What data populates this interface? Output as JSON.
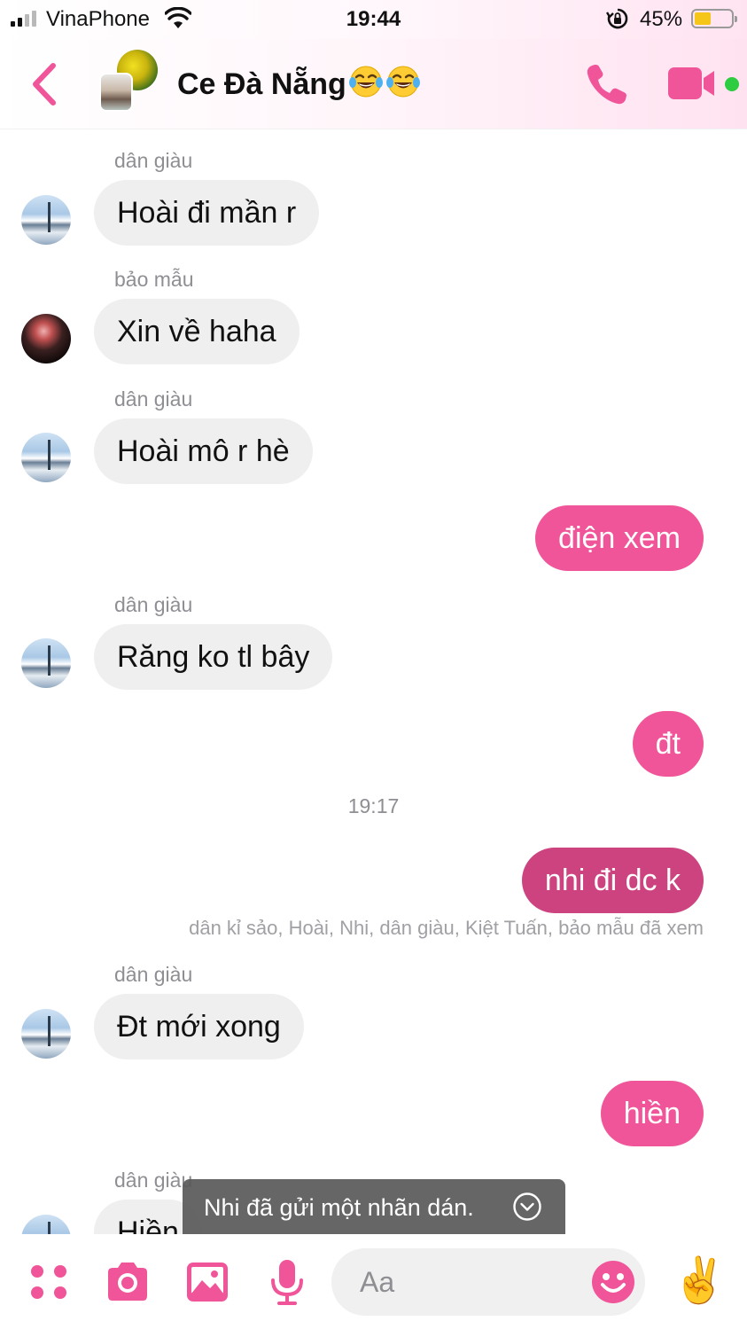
{
  "status_bar": {
    "carrier": "VinaPhone",
    "time": "19:44",
    "battery_percent": "45%",
    "battery_level": 0.45
  },
  "header": {
    "title": "Ce Đà Nẵng",
    "title_emojis": [
      "face-with-tears-of-joy",
      "face-with-tears-of-joy"
    ],
    "online": true
  },
  "colors": {
    "accent": "#f0559a",
    "accent_dark": "#cc437f",
    "incoming_bubble": "#efefef",
    "online": "#2ecc40"
  },
  "messages": [
    {
      "type": "incoming",
      "sender": "dân giàu",
      "text": "Hoài đi mần r"
    },
    {
      "type": "incoming",
      "sender": "bảo mẫu",
      "text": "Xin về haha"
    },
    {
      "type": "incoming",
      "sender": "dân giàu",
      "text": "Hoài mô r hè"
    },
    {
      "type": "outgoing",
      "text": "điện xem"
    },
    {
      "type": "incoming",
      "sender": "dân giàu",
      "text": "Răng ko tl bây"
    },
    {
      "type": "outgoing",
      "text": "đt"
    },
    {
      "type": "time",
      "text": "19:17"
    },
    {
      "type": "outgoing",
      "text": "nhi đi dc k"
    },
    {
      "type": "read_receipt",
      "text": "dân kỉ sảo, Hoài, Nhi, dân giàu, Kiệt Tuấn, bảo mẫu đã xem"
    },
    {
      "type": "incoming",
      "sender": "dân giàu",
      "text": "Đt mới xong"
    },
    {
      "type": "outgoing",
      "text": "hiền"
    },
    {
      "type": "incoming",
      "sender": "dân giàu",
      "text": "Hiền"
    }
  ],
  "toast": {
    "text": "Nhi đã gửi một nhãn dán."
  },
  "composer": {
    "placeholder": "Aa",
    "value": "",
    "buttons": [
      "more-apps-icon",
      "camera-icon",
      "gallery-icon",
      "microphone-icon",
      "emoji-icon",
      "victory-hand-icon"
    ]
  }
}
